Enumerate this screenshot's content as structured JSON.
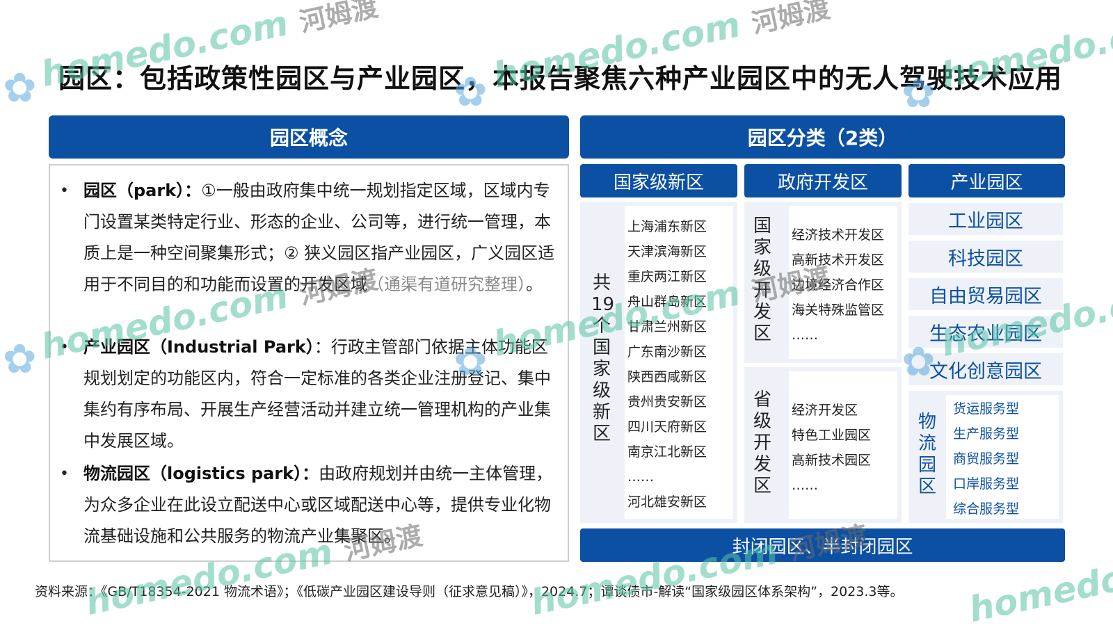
{
  "title": "园区：包括政策性园区与产业园区，本报告聚焦六种产业园区中的无人驾驶技术应用",
  "concept": {
    "header": "园区概念",
    "p1_term": "园区（park）：",
    "p1_text": "①一般由政府集中统一规划指定区域，区域内专门设置某类特定行业、形态的企业、公司等，进行统一管理，本质上是一种空间聚集形式；② 狭义园区指产业园区，广义园区适用于不同目的和功能而设置的开发区域",
    "p1_note": "（通渠有道研究整理）",
    "p1_end": "。",
    "p2_term": "产业园区（Industrial Park）",
    "p2_text": "：行政主管部门依据主体功能区规划划定的功能区内，符合一定标准的各类企业注册登记、集中集约有序布局、开展生产经营活动并建立统一管理机构的产业集中发展区域。",
    "p3_term": "物流园区（logistics park）：",
    "p3_text": "由政府规划并由统一主体管理，为众多企业在此设立配送中心或区域配送中心等，提供专业化物流基础设施和公共服务的物流产业集聚区。"
  },
  "classify": {
    "header": "园区分类（2类）",
    "col1_title": "国家级新区",
    "col2_title": "政府开发区",
    "col3_title": "产业园区",
    "col1_side": "共19个国家级新区",
    "col1_items": [
      "上海浦东新区",
      "天津滨海新区",
      "重庆两江新区",
      "舟山群岛新区",
      "甘肃兰州新区",
      "广东南沙新区",
      "陕西西咸新区",
      "贵州贵安新区",
      "四川天府新区",
      "南京江北新区",
      "……",
      "河北雄安新区"
    ],
    "col2a_side": "国家级开发区",
    "col2a_items": [
      "经济技术开发区",
      "高新技术开发区",
      "边境经济合作区",
      "海关特殊监管区",
      "……"
    ],
    "col2b_side": "省级开发区",
    "col2b_items": [
      "经济开发区",
      "特色工业园区",
      "高新技术园区",
      "……"
    ],
    "col3_items": [
      "工业园区",
      "科技园区",
      "自由贸易园区",
      "生态农业园区",
      "文化创意园区"
    ],
    "logistics_side": "物流园区",
    "logistics_items": [
      "货运服务型",
      "生产服务型",
      "商贸服务型",
      "口岸服务型",
      "综合服务型"
    ],
    "footer": "封闭园区、半封闭园区"
  },
  "source": "资料来源：《GB/T18354-2021 物流术语》；《低碳产业园区建设导则（征求意见稿）》，2024.7；谭谈债市-解读“国家级园区体系架构”，2023.3等。",
  "watermark": {
    "en": "homedo.com",
    "cn": "河姆渡"
  },
  "colors": {
    "primary": "#0b50a3",
    "panel": "#eef2f8",
    "watermark_green": "#59c3a5"
  }
}
